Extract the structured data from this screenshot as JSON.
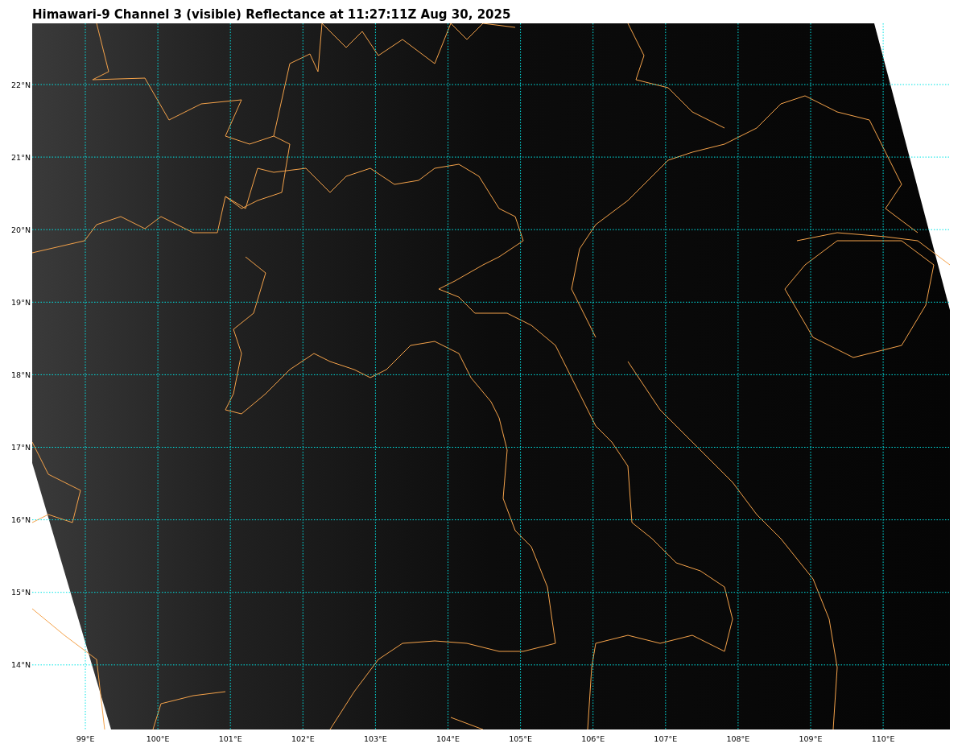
{
  "title": "Himawari-9 Channel 3 (visible) Reflectance at 11:27:11Z Aug 30, 2025",
  "map": {
    "lat_labels": [
      "22°N",
      "21°N",
      "20°N",
      "19°N",
      "18°N",
      "17°N",
      "16°N",
      "15°N",
      "14°N"
    ],
    "lon_labels": [
      "99°E",
      "100°E",
      "101°E",
      "102°E",
      "103°E",
      "104°E",
      "105°E",
      "106°E",
      "107°E",
      "108°E",
      "109°E",
      "110°E"
    ]
  }
}
